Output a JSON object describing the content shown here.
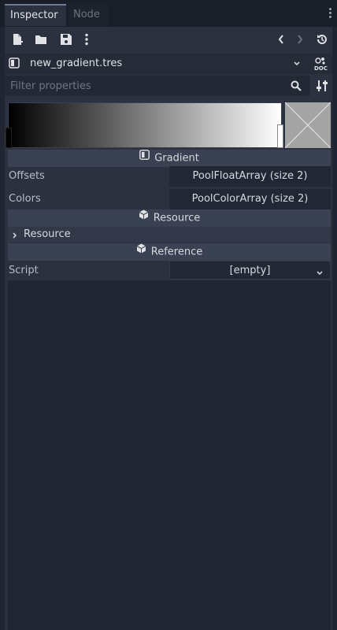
{
  "tabs": [
    {
      "label": "Inspector",
      "active": true
    },
    {
      "label": "Node",
      "active": false
    }
  ],
  "toolbar": {
    "icons": [
      "new-resource-icon",
      "open-folder-icon",
      "save-icon",
      "more-icon",
      "back-icon",
      "forward-icon",
      "history-icon"
    ]
  },
  "resource": {
    "name": "new_gradient.tres",
    "doc_label": "DOC"
  },
  "filter": {
    "placeholder": "Filter properties"
  },
  "gradient": {
    "start_color": "#000000",
    "end_color": "#ffffff"
  },
  "sections": {
    "gradient": "Gradient",
    "resource": "Resource",
    "reference": "Reference"
  },
  "properties": {
    "offsets_label": "Offsets",
    "offsets_value": "PoolFloatArray (size 2)",
    "colors_label": "Colors",
    "colors_value": "PoolColorArray (size 2)",
    "resource_sub": "Resource",
    "script_label": "Script",
    "script_value": "[empty]"
  }
}
